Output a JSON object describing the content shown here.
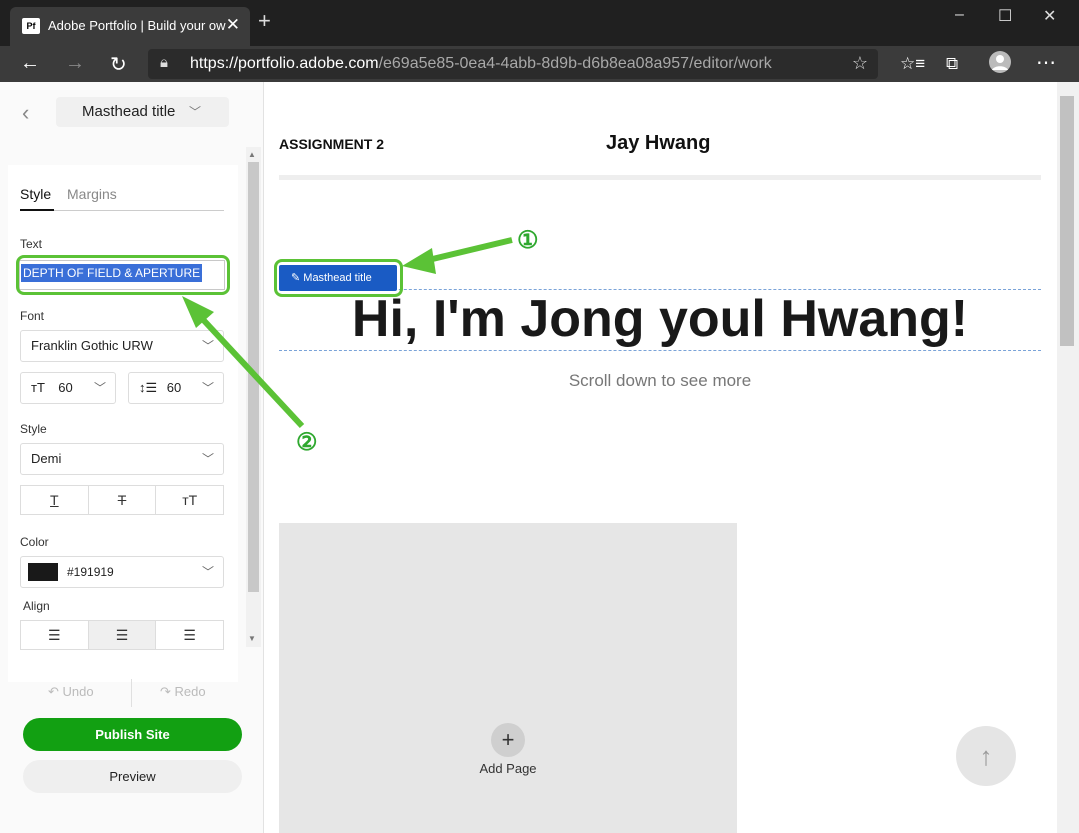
{
  "browser": {
    "tab_title": "Adobe Portfolio | Build your own",
    "favicon_text": "Pf",
    "url_host": "https://portfolio.adobe.com",
    "url_path": "/e69a5e85-0ea4-4abb-8d9b-d6b8ea08a957/editor/work"
  },
  "panel": {
    "title": "Masthead title",
    "tabs": [
      "Style",
      "Margins"
    ],
    "text_label": "Text",
    "text_value": "DEPTH OF FIELD & APERTURE",
    "font_label": "Font",
    "font_value": "Franklin Gothic URW",
    "font_size": "60",
    "line_height": "60",
    "style_label": "Style",
    "style_value": "Demi",
    "color_label": "Color",
    "color_value": "#191919",
    "align_label": "Align",
    "undo_label": "Undo",
    "redo_label": "Redo",
    "publish_label": "Publish Site",
    "preview_label": "Preview"
  },
  "canvas": {
    "assignment": "ASSIGNMENT 2",
    "owner": "Jay Hwang",
    "badge": "Masthead title",
    "hero": "Hi, I'm Jong youl Hwang!",
    "subtitle": "Scroll down to see more",
    "add_page": "Add Page"
  },
  "annotations": {
    "callout_1": "①",
    "callout_2": "②"
  },
  "colors": {
    "highlight": "#5bc236",
    "publish": "#12a012",
    "badge": "#1a5bc4"
  }
}
